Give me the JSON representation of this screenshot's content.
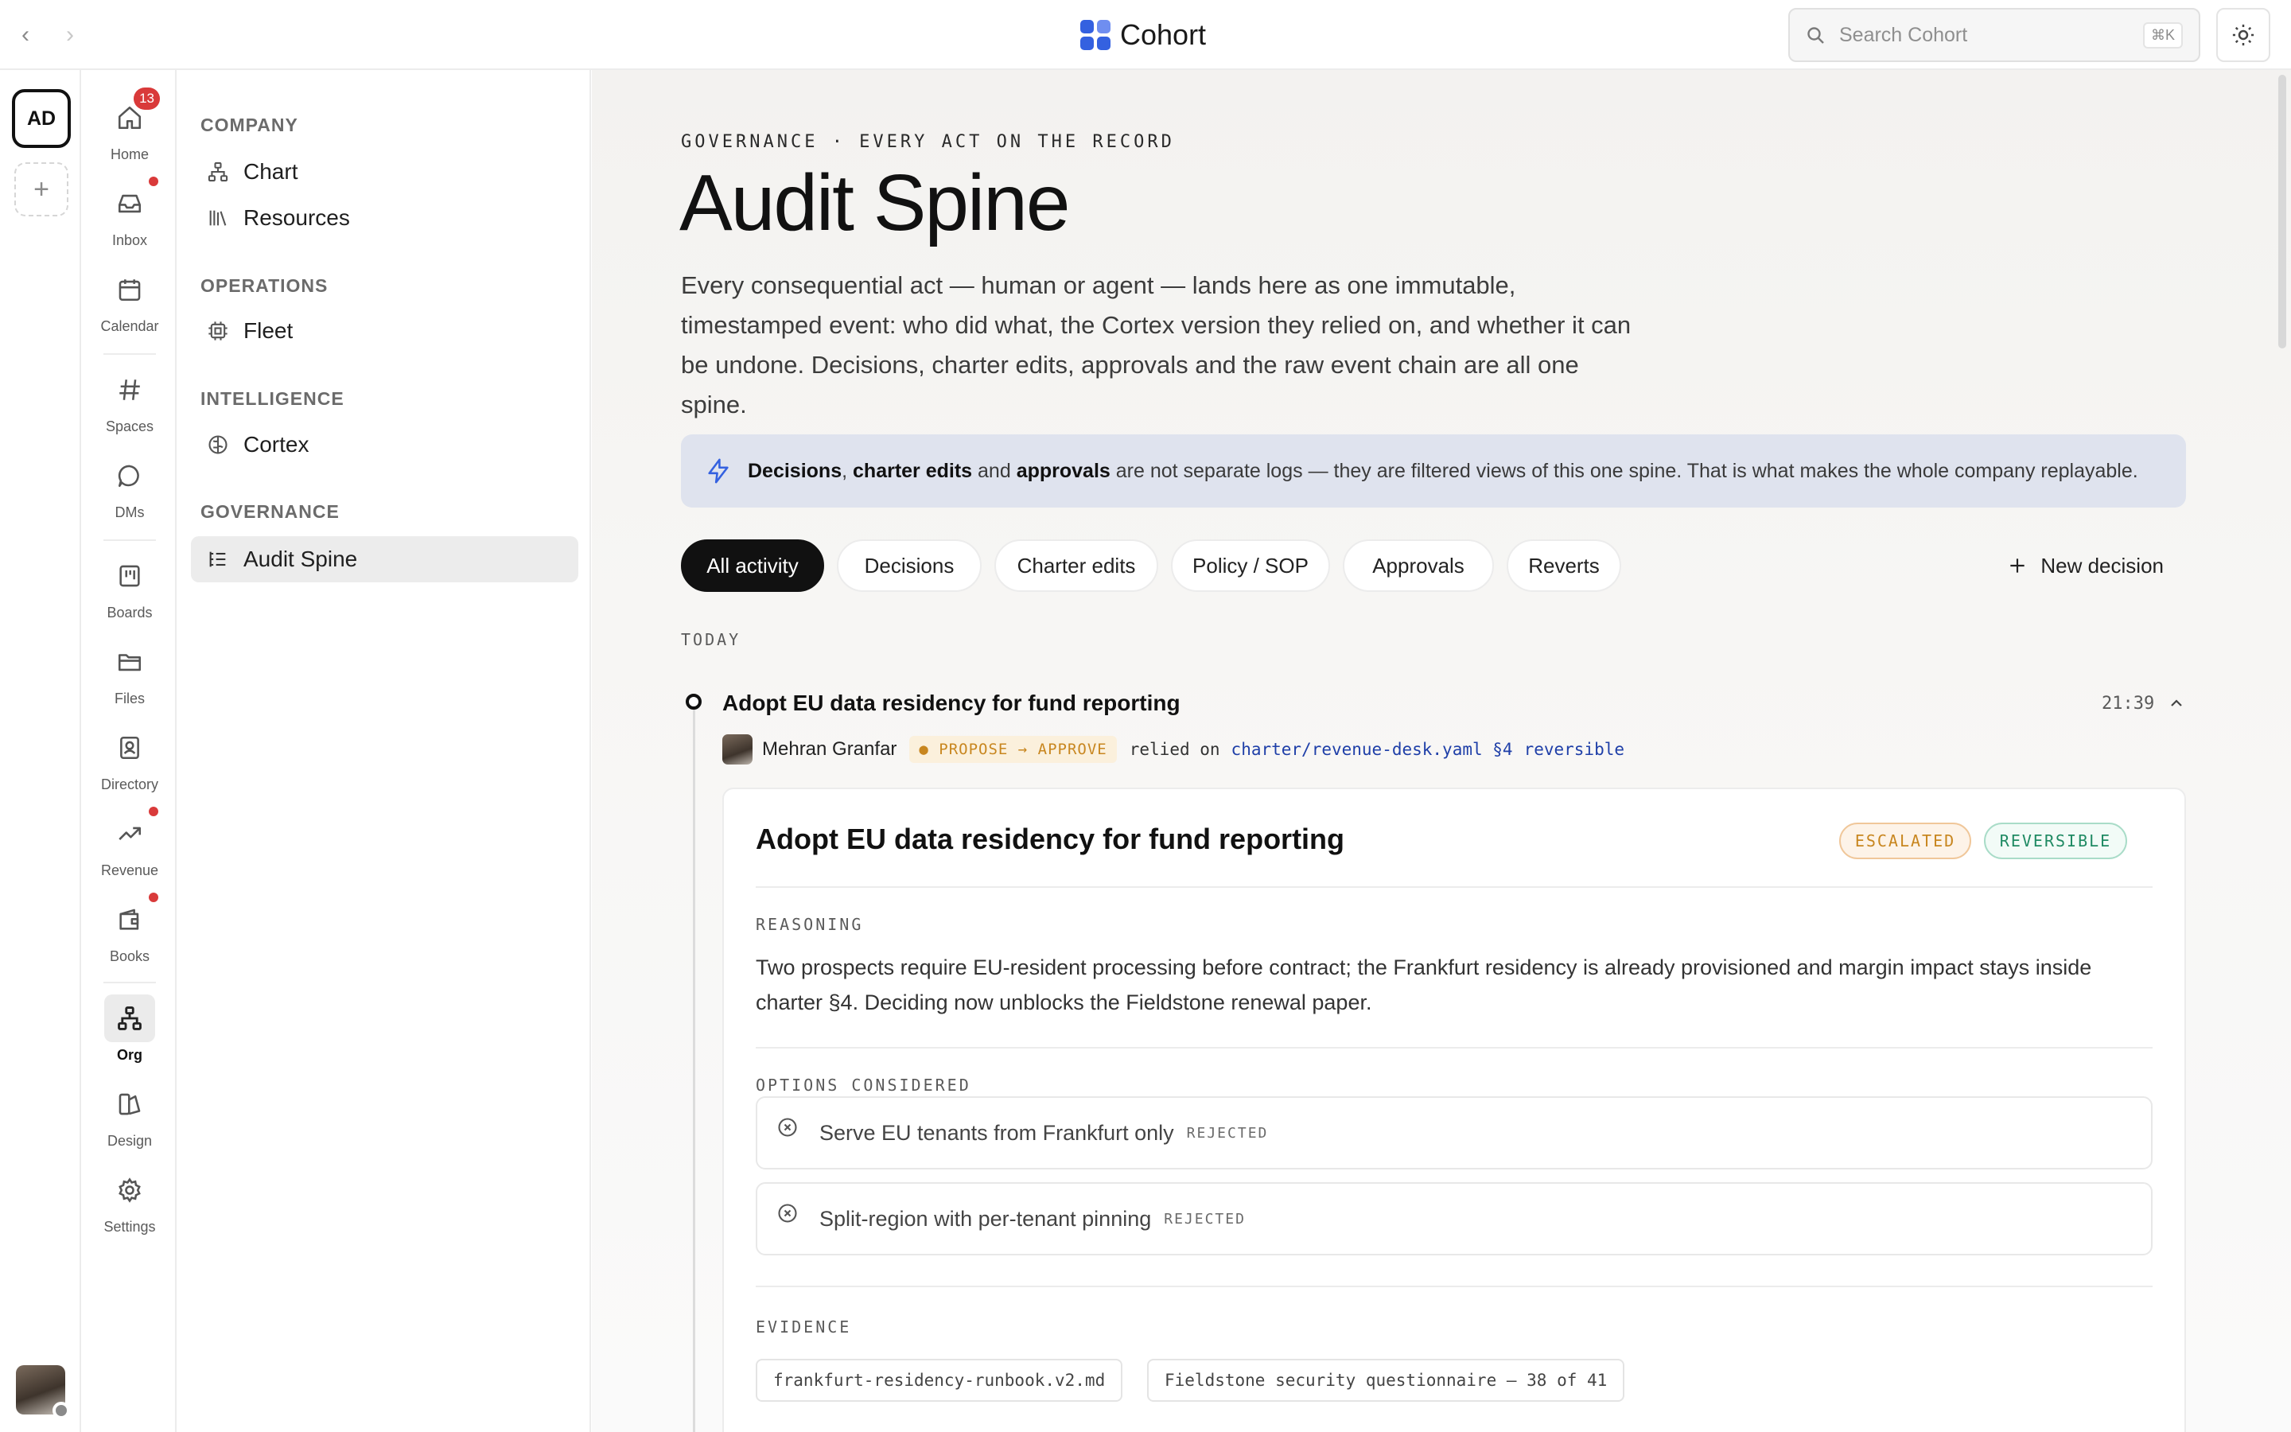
{
  "topbar": {
    "brand_name": "Cohort",
    "search_placeholder": "Search Cohort",
    "search_shortcut": "⌘K"
  },
  "workspace": {
    "initials": "AD"
  },
  "app_nav": [
    {
      "label": "Home",
      "icon": "home-icon",
      "badge": "13"
    },
    {
      "label": "Inbox",
      "icon": "inbox-icon",
      "dot": true
    },
    {
      "label": "Calendar",
      "icon": "calendar-icon"
    },
    {
      "label": "Spaces",
      "icon": "hash-icon"
    },
    {
      "label": "DMs",
      "icon": "message-icon"
    },
    {
      "label": "Boards",
      "icon": "board-icon"
    },
    {
      "label": "Files",
      "icon": "folder-icon"
    },
    {
      "label": "Directory",
      "icon": "contact-icon"
    },
    {
      "label": "Revenue",
      "icon": "trending-up-icon",
      "dot": true
    },
    {
      "label": "Books",
      "icon": "wallet-icon",
      "dot": true
    },
    {
      "label": "Org",
      "icon": "org-chart-icon",
      "active": true
    },
    {
      "label": "Design",
      "icon": "design-icon"
    },
    {
      "label": "Settings",
      "icon": "gear-icon"
    }
  ],
  "sidebar": {
    "groups": [
      {
        "title": "COMPANY",
        "items": [
          {
            "label": "Chart",
            "icon": "org-chart-icon"
          },
          {
            "label": "Resources",
            "icon": "library-icon"
          }
        ]
      },
      {
        "title": "OPERATIONS",
        "items": [
          {
            "label": "Fleet",
            "icon": "cpu-icon"
          }
        ]
      },
      {
        "title": "INTELLIGENCE",
        "items": [
          {
            "label": "Cortex",
            "icon": "brain-icon"
          }
        ]
      },
      {
        "title": "GOVERNANCE",
        "items": [
          {
            "label": "Audit Spine",
            "icon": "list-icon",
            "active": true
          }
        ]
      }
    ]
  },
  "main": {
    "eyebrow": "GOVERNANCE · EVERY ACT ON THE RECORD",
    "title": "Audit Spine",
    "description": "Every consequential act — human or agent — lands here as one immutable, timestamped event: who did what, the Cortex version they relied on, and whether it can be undone. Decisions, charter edits, approvals and the raw event chain are all one spine.",
    "callout": {
      "bold1": "Decisions",
      "sep1": ", ",
      "bold2": "charter edits",
      "sep2": " and ",
      "bold3": "approvals",
      "rest": " are not separate logs — they are filtered views of this one spine. That is what makes the whole company replayable."
    },
    "filters": [
      "All activity",
      "Decisions",
      "Charter edits",
      "Policy / SOP",
      "Approvals",
      "Reverts"
    ],
    "active_filter": "All activity",
    "new_decision_label": "New decision",
    "day_label": "TODAY",
    "event": {
      "title": "Adopt EU data residency for fund reporting",
      "time": "21:39",
      "actor": "Mehran Granfar",
      "badge": "● PROPOSE → APPROVE",
      "relied_on_label": "relied on",
      "charter_ref": "charter/revenue-desk.yaml §4",
      "reversibility": "reversible"
    },
    "card": {
      "title": "Adopt EU data residency for fund reporting",
      "status_pills": [
        "ESCALATED",
        "REVERSIBLE"
      ],
      "reasoning_label": "REASONING",
      "reasoning": "Two prospects require EU-resident processing before contract; the Frankfurt residency is already provisioned and margin impact stays inside charter §4. Deciding now unblocks the Fieldstone renewal paper.",
      "options_label": "OPTIONS CONSIDERED",
      "options": [
        {
          "text": "Serve EU tenants from Frankfurt only",
          "status": "REJECTED"
        },
        {
          "text": "Split-region with per-tenant pinning",
          "status": "REJECTED"
        }
      ],
      "evidence_label": "EVIDENCE",
      "evidence": [
        "frankfurt-residency-runbook.v2.md",
        "Fieldstone security questionnaire — 38 of 41"
      ]
    }
  },
  "colors": {
    "accent": "#3461e0",
    "badge_red": "#d93a3a",
    "callout_bg": "#dfe3ee",
    "escalated": "#c8861f",
    "reversible": "#1f8a63"
  }
}
